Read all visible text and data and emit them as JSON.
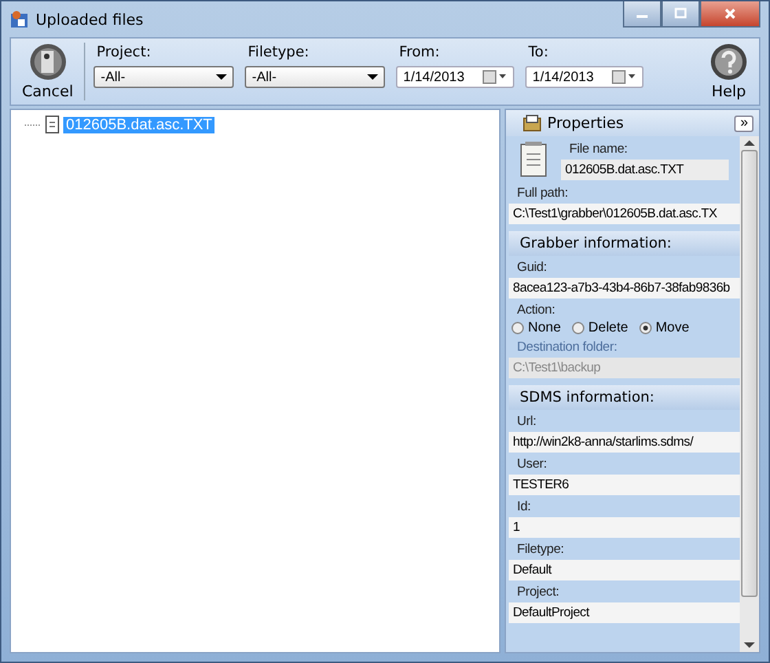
{
  "window": {
    "title": "Uploaded files"
  },
  "toolbar": {
    "cancel_button": "Cancel",
    "help_button": "Help",
    "filters": [
      {
        "kind": "dropdown",
        "label": "Project:",
        "value": "-All-"
      },
      {
        "kind": "dropdown",
        "label": "Filetype:",
        "value": "-All-"
      },
      {
        "kind": "date",
        "label": "From:",
        "value": "1/14/2013"
      },
      {
        "kind": "date",
        "label": "To:",
        "value": "1/14/2013"
      }
    ]
  },
  "tree": {
    "items": [
      {
        "label": "012605B.dat.asc.TXT",
        "selected": true
      }
    ]
  },
  "properties": {
    "title": "Properties",
    "expand_button": "»",
    "file_name_label": "File name:",
    "file_name": "012605B.dat.asc.TXT",
    "groups": [
      {
        "fields": [
          {
            "kind": "text",
            "label": "Full path:",
            "value": "C:\\Test1\\grabber\\012605B.dat.asc.TX",
            "disabled": false
          }
        ]
      },
      {
        "title": "Grabber information:",
        "fields": [
          {
            "kind": "text",
            "label": "Guid:",
            "value": "8acea123-a7b3-43b4-86b7-38fab9836b",
            "disabled": false
          },
          {
            "kind": "radio",
            "label": "Action:",
            "options": [
              {
                "label": "None",
                "selected": false
              },
              {
                "label": "Delete",
                "selected": false
              },
              {
                "label": "Move",
                "selected": true
              }
            ]
          },
          {
            "kind": "text",
            "label": "Destination folder:",
            "value": "C:\\Test1\\backup",
            "disabled": true
          }
        ]
      },
      {
        "title": "SDMS information:",
        "fields": [
          {
            "kind": "text",
            "label": "Url:",
            "value": "http://win2k8-anna/starlims.sdms/",
            "disabled": false
          },
          {
            "kind": "text",
            "label": "User:",
            "value": "TESTER6",
            "disabled": false
          },
          {
            "kind": "text",
            "label": "Id:",
            "value": "1",
            "disabled": false
          },
          {
            "kind": "text",
            "label": "Filetype:",
            "value": "Default",
            "disabled": false
          },
          {
            "kind": "text",
            "label": "Project:",
            "value": "DefaultProject",
            "disabled": false
          }
        ]
      }
    ]
  }
}
